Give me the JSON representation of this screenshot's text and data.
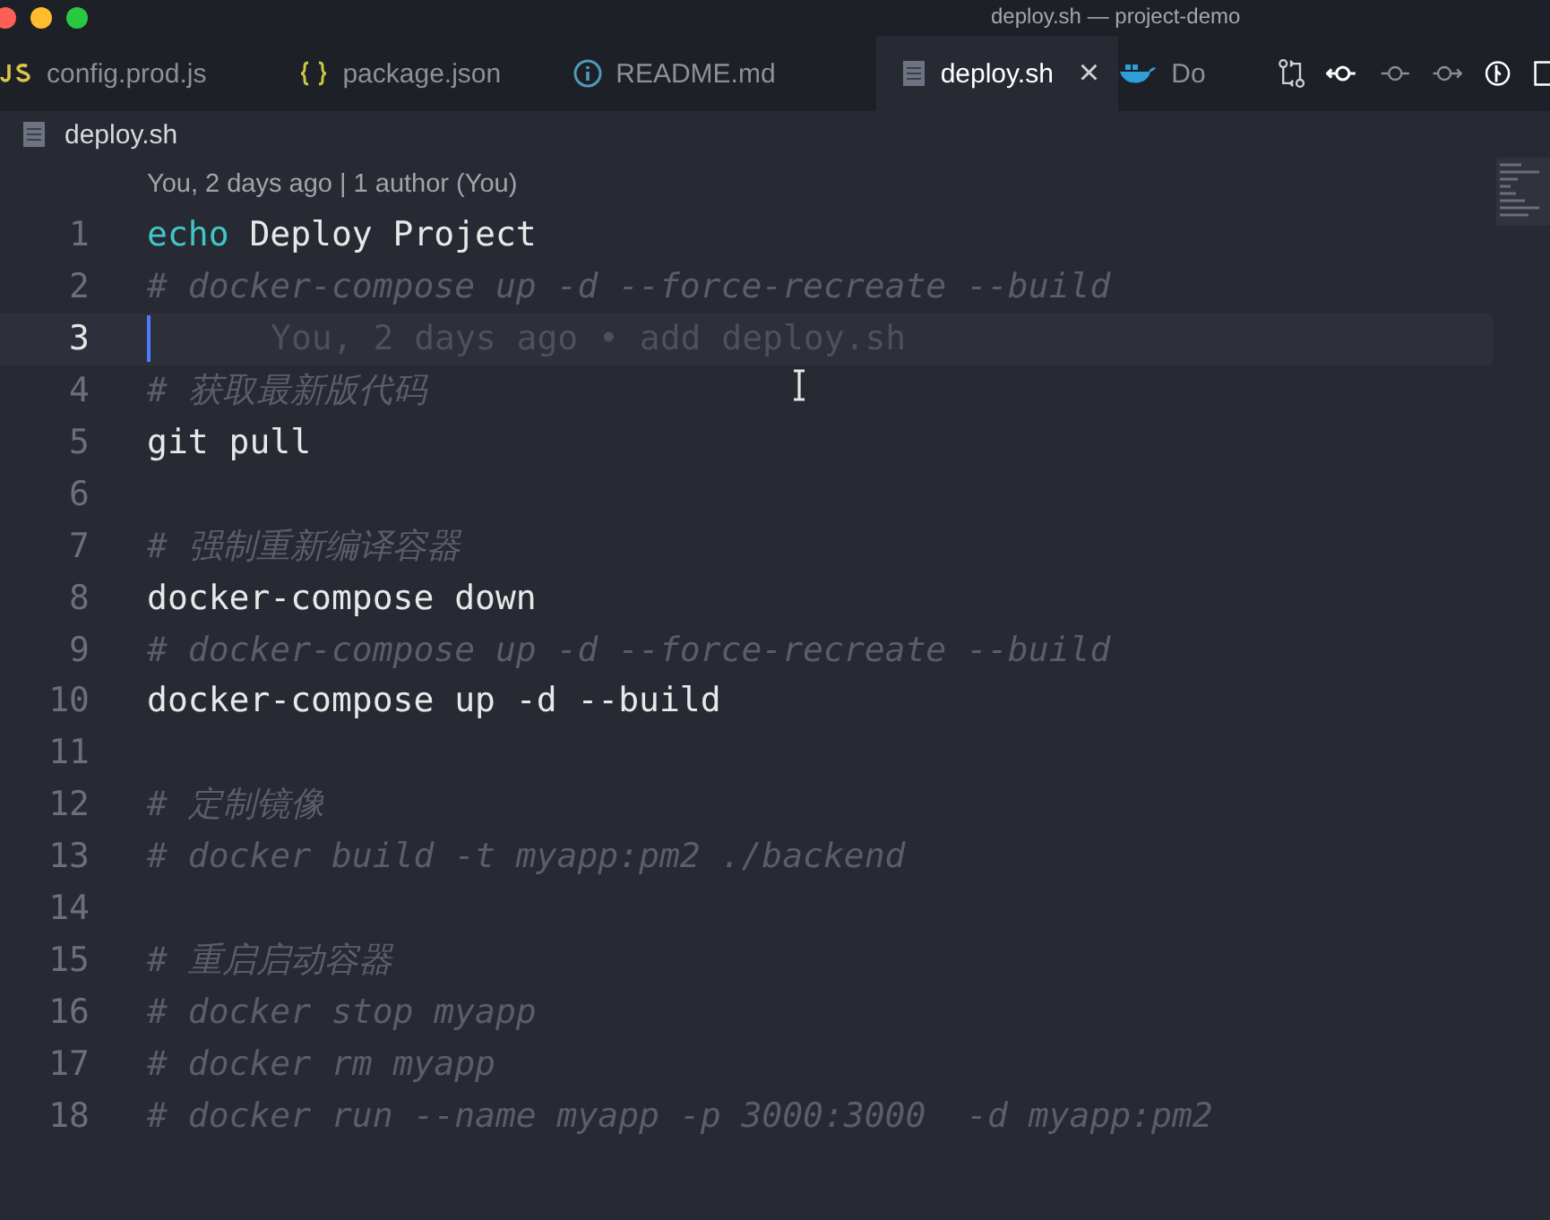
{
  "window": {
    "title": "deploy.sh — project-demo"
  },
  "tabs": [
    {
      "label": "config.prod.js",
      "kind": "js",
      "selected": false
    },
    {
      "label": "package.json",
      "kind": "json",
      "selected": false
    },
    {
      "label": "README.md",
      "kind": "markdown",
      "selected": false
    },
    {
      "label": "deploy.sh",
      "kind": "shell",
      "selected": true,
      "close": "×"
    },
    {
      "label": "Do",
      "kind": "docker",
      "selected": false
    }
  ],
  "breadcrumb": "deploy.sh",
  "codelens": "You, 2 days ago | 1 author (You)",
  "lines": [
    {
      "number": "1",
      "current": false,
      "tokens": [
        {
          "text": "echo",
          "kind": "keyword"
        },
        {
          "text": " Deploy Project",
          "kind": "plain"
        }
      ]
    },
    {
      "number": "2",
      "current": false,
      "tokens": [
        {
          "text": "# docker-compose up -d --force-recreate --build",
          "kind": "comment"
        }
      ]
    },
    {
      "number": "3",
      "current": true,
      "blame": "You, 2 days ago • add deploy.sh"
    },
    {
      "number": "4",
      "current": false,
      "tokens": [
        {
          "text": "# 获取最新版代码",
          "kind": "comment"
        }
      ]
    },
    {
      "number": "5",
      "current": false,
      "tokens": [
        {
          "text": "git pull",
          "kind": "plain"
        }
      ]
    },
    {
      "number": "6",
      "current": false
    },
    {
      "number": "7",
      "current": false,
      "tokens": [
        {
          "text": "# 强制重新编译容器",
          "kind": "comment"
        }
      ]
    },
    {
      "number": "8",
      "current": false,
      "tokens": [
        {
          "text": "docker-compose down",
          "kind": "plain"
        }
      ]
    },
    {
      "number": "9",
      "current": false,
      "tokens": [
        {
          "text": "# docker-compose up -d --force-recreate --build",
          "kind": "comment"
        }
      ]
    },
    {
      "number": "10",
      "current": false,
      "tokens": [
        {
          "text": "docker-compose up -d --build",
          "kind": "plain"
        }
      ]
    },
    {
      "number": "11",
      "current": false
    },
    {
      "number": "12",
      "current": false,
      "tokens": [
        {
          "text": "# 定制镜像",
          "kind": "comment"
        }
      ]
    },
    {
      "number": "13",
      "current": false,
      "tokens": [
        {
          "text": "# docker build -t myapp:pm2 ./backend",
          "kind": "comment"
        }
      ]
    },
    {
      "number": "14",
      "current": false
    },
    {
      "number": "15",
      "current": false,
      "tokens": [
        {
          "text": "# 重启启动容器",
          "kind": "comment"
        }
      ]
    },
    {
      "number": "16",
      "current": false,
      "tokens": [
        {
          "text": "# docker stop myapp",
          "kind": "comment"
        }
      ]
    },
    {
      "number": "17",
      "current": false,
      "tokens": [
        {
          "text": "# docker rm myapp",
          "kind": "comment"
        }
      ]
    },
    {
      "number": "18",
      "current": false,
      "tokens": [
        {
          "text": "# docker run --name myapp -p 3000:3000  -d myapp:pm2",
          "kind": "comment"
        }
      ]
    }
  ]
}
